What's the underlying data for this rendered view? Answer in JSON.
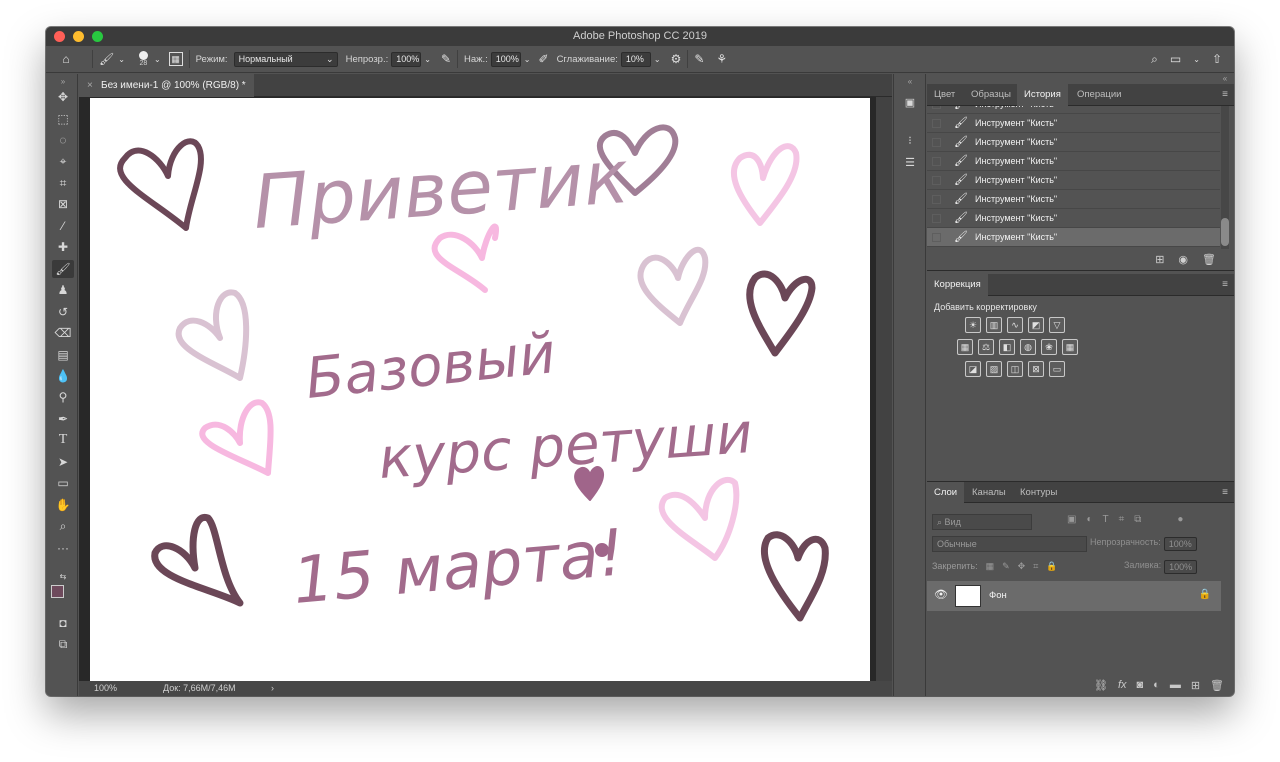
{
  "app": {
    "title": "Adobe Photoshop CC 2019"
  },
  "options": {
    "brush_size": "28",
    "mode_label": "Режим:",
    "mode_value": "Нормальный",
    "opacity_label": "Непрозр.:",
    "opacity_value": "100%",
    "pressure_label": "Наж.:",
    "pressure_value": "100%",
    "smoothing_label": "Сглаживание:",
    "smoothing_value": "10%"
  },
  "document": {
    "tab_title": "Без имени-1 @ 100% (RGB/8) *",
    "close": "×",
    "zoom": "100%",
    "doc_info": "Док: 7,66M/7,46M",
    "arrow": "›"
  },
  "artwork": {
    "line1": "Приветик",
    "line2": "Базовый",
    "line3": "курс ретуши",
    "line4": "15 марта!"
  },
  "top_panel": {
    "tabs": [
      "Цвет",
      "Образцы",
      "История",
      "Операции"
    ],
    "active_tab": "История",
    "history": [
      "Инструмент \"Кисть\"",
      "Инструмент \"Кисть\"",
      "Инструмент \"Кисть\"",
      "Инструмент \"Кисть\"",
      "Инструмент \"Кисть\"",
      "Инструмент \"Кисть\"",
      "Инструмент \"Кисть\"",
      "Инструмент \"Кисть\""
    ]
  },
  "adjustments": {
    "tab": "Коррекция",
    "subtitle": "Добавить корректировку"
  },
  "layers": {
    "tabs": [
      "Слои",
      "Каналы",
      "Контуры"
    ],
    "active_tab": "Слои",
    "filter_placeholder": "Вид",
    "blend_mode": "Обычные",
    "opacity_label": "Непрозрачность:",
    "opacity_value": "100%",
    "lock_label": "Закрепить:",
    "fill_label": "Заливка:",
    "fill_value": "100%",
    "layer_name": "Фон"
  },
  "colors": {
    "foreground": "#6e4a5c",
    "background": "#ffffff"
  }
}
